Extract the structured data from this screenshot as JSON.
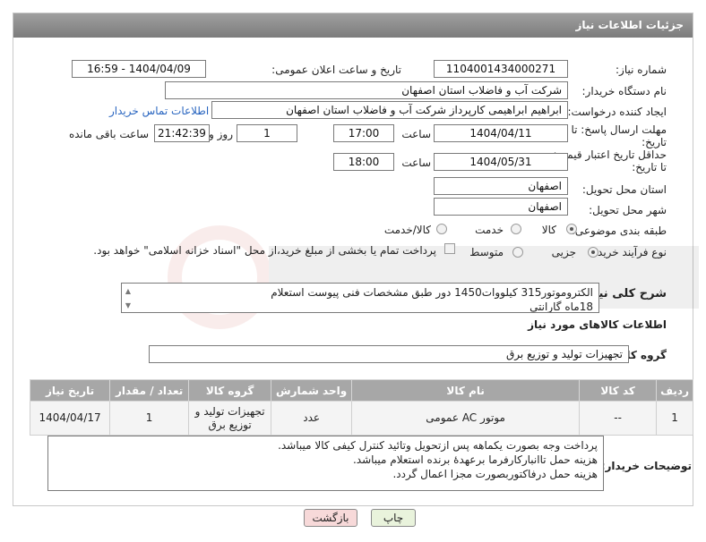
{
  "header": {
    "title": "جزئیات اطلاعات نیاز"
  },
  "fields": {
    "need_number_label": "شماره نیاز:",
    "need_number": "1104001434000271",
    "announce_label": "تاریخ و ساعت اعلان عمومی:",
    "announce_value": "1404/04/09 - 16:59",
    "buyer_org_label": "نام دستگاه خریدار:",
    "buyer_org": "شرکت آب و فاضلاب استان اصفهان",
    "creator_label": "ایجاد کننده درخواست:",
    "creator": "ابراهیم ابراهیمی کارپرداز شرکت آب و فاضلاب استان اصفهان",
    "contact_link": "اطلاعات تماس خریدار",
    "deadline_label": "مهلت ارسال پاسخ: تا تاریخ:",
    "deadline_date": "1404/04/11",
    "time_label": "ساعت",
    "deadline_time": "17:00",
    "days_value": "1",
    "days_label": "روز و",
    "remaining_time": "21:42:39",
    "remaining_label": "ساعت باقی مانده",
    "price_validity_label": "حداقل تاریخ اعتبار قیمت: تا تاریخ:",
    "price_validity_date": "1404/05/31",
    "price_validity_time": "18:00",
    "province_label": "استان محل تحویل:",
    "province": "اصفهان",
    "city_label": "شهر محل تحویل:",
    "city": "اصفهان",
    "category_label": "طبقه بندی موضوعی:",
    "category_options": [
      "کالا",
      "خدمت",
      "کالا/خدمت"
    ],
    "process_label": "نوع فرآیند خرید :",
    "process_options": [
      "جزیی",
      "متوسط"
    ],
    "payment_note": "پرداخت تمام یا بخشی از مبلغ خرید،از محل \"اسناد خزانه اسلامی\" خواهد بود."
  },
  "description": {
    "label": "شرح کلی نیاز:",
    "line1": "الکتروموتور315 کیلووات1450 دور طبق مشخصات فنی پیوست استعلام",
    "line2": "18ماه گارانتی"
  },
  "goods": {
    "section_title": "اطلاعات کالاهای مورد نیاز",
    "group_label": "گروه کالا:",
    "group_value": "تجهیزات تولید و توزیع برق",
    "columns": [
      "ردیف",
      "کد کالا",
      "نام کالا",
      "واحد شمارش",
      "گروه کالا",
      "تعداد / مقدار",
      "تاریخ نیاز"
    ],
    "rows": [
      {
        "row": "1",
        "code": "--",
        "name": "موتور AC عمومی",
        "unit": "عدد",
        "group": "تجهیزات تولید و توزیع برق",
        "qty": "1",
        "date": "1404/04/17"
      }
    ]
  },
  "buyer_notes": {
    "label": "توضیحات خریدار:",
    "line1": "پرداخت وجه بصورت یکماهه پس ازتحویل وتائید کنترل کیفی کالا میباشد.",
    "line2": "هزینه حمل تاانبارکارفرما برعهدهٔ برنده استعلام میباشد.",
    "line3": "هزینه حمل درفاکتوربصورت مجزا اعمال گردد."
  },
  "buttons": {
    "print": "چاپ",
    "back": "بازگشت"
  },
  "colors": {
    "header_bg": "#8c8c8c",
    "link": "#2a66c0",
    "back_bg": "#f7d9d9",
    "print_bg": "#e9f3dc"
  }
}
